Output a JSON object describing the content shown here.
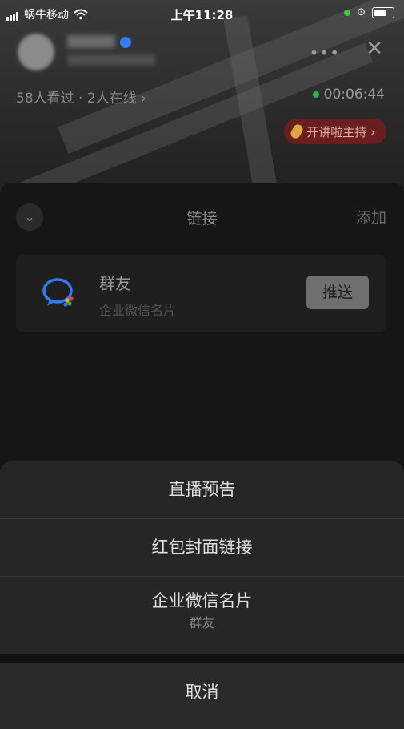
{
  "status_bar": {
    "carrier": "蜗牛移动",
    "time": "上午11:28"
  },
  "header": {
    "viewers_text": "58人看过 · 2人在线 ›",
    "duration": "00:06:44",
    "host_button": "开讲啦主持 ›",
    "more_icon": "more-dots-icon",
    "close_icon": "close-icon"
  },
  "panel": {
    "title": "链接",
    "add_label": "添加",
    "collapse_icon": "chevron-down-icon",
    "card": {
      "name": "群友",
      "description": "企业微信名片",
      "push_label": "推送",
      "icon": "wecom-icon"
    }
  },
  "sheet": {
    "options": [
      {
        "label": "直播预告"
      },
      {
        "label": "红包封面链接"
      },
      {
        "label": "企业微信名片",
        "subtitle": "群友"
      }
    ],
    "cancel_label": "取消"
  },
  "colors": {
    "accent_green": "#2bb34a",
    "host_bg": "#6a1f1f",
    "wecom_blue": "#2f7cf6"
  }
}
